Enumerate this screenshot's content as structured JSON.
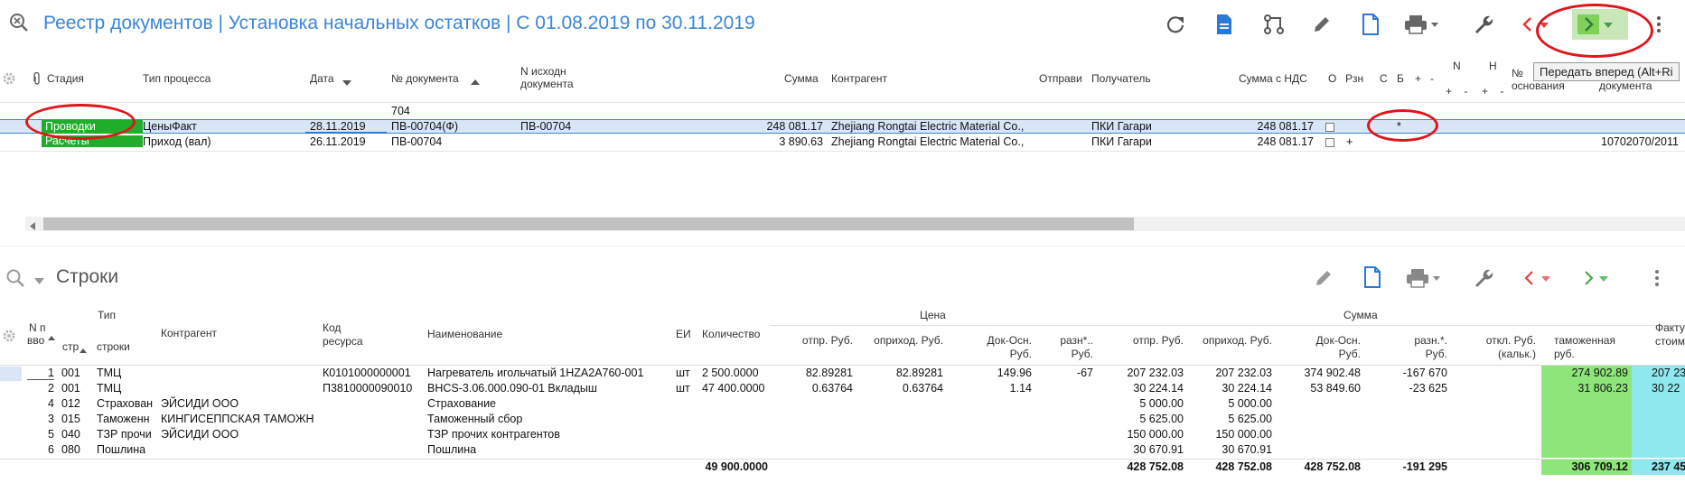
{
  "header": {
    "title": "Реестр документов | Установка начальных остатков | С 01.08.2019 по 30.11.2019",
    "tooltip": "Передать вперед (Alt+Ri"
  },
  "upper_table": {
    "columns": {
      "stage": "Стадия",
      "process_type": "Тип процесса",
      "date": "Дата",
      "doc_no": "№ документа",
      "orig_doc": "N исходн документа",
      "sum": "Сумма",
      "counterparty": "Контрагент",
      "sender": "Отправи",
      "receiver": "Получатель",
      "sum_vat": "Сумма с НДС",
      "o": "О",
      "rzn": "Рзн",
      "s": "С",
      "b": "Б",
      "plus": "+",
      "minus": "-",
      "n": "N",
      "h": "Н",
      "n_sub": "+ -",
      "h_sub": "+ -",
      "basis_no": "№ основания",
      "doc_col": "документа"
    },
    "filter_value": "704",
    "rows": [
      {
        "stage": "Проводки",
        "process_type": "ЦеныФакт",
        "date": "28.11.2019",
        "doc_no": "ПВ-00704(Ф)",
        "orig_doc": "ПВ-00704",
        "sum": "248 081.17",
        "counterparty": "Zhejiang Rongtai Electric Material Co.,",
        "receiver": "ПКИ Гагари",
        "sum_vat": "248 081.17",
        "b": "*",
        "extra": ""
      },
      {
        "stage": "Расчеты",
        "process_type": "Приход (вал)",
        "date": "26.11.2019",
        "doc_no": "ПВ-00704",
        "orig_doc": "",
        "sum": "3 890.63",
        "counterparty": "Zhejiang Rongtai Electric Material Co.,",
        "receiver": "ПКИ Гагари",
        "sum_vat": "248 081.17",
        "b": "+",
        "extra": "10702070/2011"
      }
    ]
  },
  "lower": {
    "title": "Строки",
    "headers": {
      "n": "N п",
      "vvod": "вво",
      "type": "Тип",
      "str": "стр",
      "stroki": "строки",
      "counterparty": "Контрагент",
      "resource_code": "Код ресурса",
      "name": "Наименование",
      "ei": "ЕИ",
      "qty": "Количество",
      "price_group": "Цена",
      "sum_group": "Сумма",
      "otpr_rub": "отпр. Руб.",
      "oprihod_rub": "оприход. Руб.",
      "dok_osn_rub": "Док-Осн. Руб.",
      "razn_rub": "разн*.. Руб.",
      "s_otpr_rub": "отпр. Руб.",
      "s_oprihod_rub": "оприход. Руб.",
      "s_dok_osn_rub": "Док-Осн. Руб.",
      "s_razn_rub": "разн.*. Руб.",
      "otkl": "откл. Руб.(кальк.)",
      "customs": "таможенная руб.",
      "fact": "Факту стоим"
    },
    "rows": [
      {
        "n": "1",
        "str": "001",
        "type": "ТМЦ",
        "counterparty": "",
        "code": "К0101000000001",
        "name": "Нагреватель игольчатый 1HZA2A760-001",
        "ei": "шт",
        "qty": "2 500.0000",
        "p_otpr": "82.89281",
        "p_oprihod": "82.89281",
        "p_dok": "149.96",
        "p_razn": "-67",
        "s_otpr": "207 232.03",
        "s_oprihod": "207 232.03",
        "s_dok": "374 902.48",
        "s_razn": "-167 670",
        "otkl": "",
        "customs": "274 902.89",
        "fact": "207 23"
      },
      {
        "n": "2",
        "str": "001",
        "type": "ТМЦ",
        "counterparty": "",
        "code": "П3810000090010",
        "name": "BHCS-3.06.000.090-01 Вкладыш",
        "ei": "шт",
        "qty": "47 400.0000",
        "p_otpr": "0.63764",
        "p_oprihod": "0.63764",
        "p_dok": "1.14",
        "p_razn": "",
        "s_otpr": "30 224.14",
        "s_oprihod": "30 224.14",
        "s_dok": "53 849.60",
        "s_razn": "-23 625",
        "otkl": "",
        "customs": "31 806.23",
        "fact": "30 22"
      },
      {
        "n": "4",
        "str": "012",
        "type": "Страхован",
        "counterparty": "ЭЙСИДИ ООО",
        "code": "",
        "name": "Страхование",
        "ei": "",
        "qty": "",
        "p_otpr": "",
        "p_oprihod": "",
        "p_dok": "",
        "p_razn": "",
        "s_otpr": "5 000.00",
        "s_oprihod": "5 000.00",
        "s_dok": "",
        "s_razn": "",
        "otkl": "",
        "customs": "",
        "fact": ""
      },
      {
        "n": "3",
        "str": "015",
        "type": "Таможенн",
        "counterparty": "КИНГИСЕППСКАЯ ТАМОЖН",
        "code": "",
        "name": "Таможенный сбор",
        "ei": "",
        "qty": "",
        "p_otpr": "",
        "p_oprihod": "",
        "p_dok": "",
        "p_razn": "",
        "s_otpr": "5 625.00",
        "s_oprihod": "5 625.00",
        "s_dok": "",
        "s_razn": "",
        "otkl": "",
        "customs": "",
        "fact": ""
      },
      {
        "n": "5",
        "str": "040",
        "type": "ТЗР прочи",
        "counterparty": "ЭЙСИДИ ООО",
        "code": "",
        "name": "ТЗР прочих контрагентов",
        "ei": "",
        "qty": "",
        "p_otpr": "",
        "p_oprihod": "",
        "p_dok": "",
        "p_razn": "",
        "s_otpr": "150 000.00",
        "s_oprihod": "150 000.00",
        "s_dok": "",
        "s_razn": "",
        "otkl": "",
        "customs": "",
        "fact": ""
      },
      {
        "n": "6",
        "str": "080",
        "type": "Пошлина",
        "counterparty": "",
        "code": "",
        "name": "Пошлина",
        "ei": "",
        "qty": "",
        "p_otpr": "",
        "p_oprihod": "",
        "p_dok": "",
        "p_razn": "",
        "s_otpr": "30 670.91",
        "s_oprihod": "30 670.91",
        "s_dok": "",
        "s_razn": "",
        "otkl": "",
        "customs": "",
        "fact": ""
      }
    ],
    "totals": {
      "qty": "49 900.0000",
      "s_otpr": "428 752.08",
      "s_oprihod": "428 752.08",
      "s_dok": "428 752.08",
      "s_razn": "-191 295",
      "customs": "306 709.12",
      "fact": "237 45"
    }
  },
  "colors": {
    "accent": "#3b86d8",
    "stage_green": "#1fae2a",
    "highlight_green": "#8ee67a",
    "highlight_cyan": "#8ee8ee",
    "annotation_red": "#e0141c",
    "nav_red": "#e53935",
    "nav_green": "#43a047"
  }
}
